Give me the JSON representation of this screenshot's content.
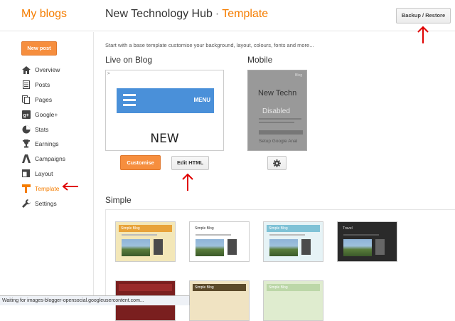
{
  "header": {
    "brand": "My blogs",
    "blog_name": "New Technology Hub",
    "separator": "·",
    "section": "Template",
    "backup_label": "Backup / Restore"
  },
  "sidebar": {
    "new_post_label": "New post",
    "items": [
      {
        "label": "Overview",
        "icon": "home-icon"
      },
      {
        "label": "Posts",
        "icon": "posts-icon"
      },
      {
        "label": "Pages",
        "icon": "pages-icon"
      },
      {
        "label": "Google+",
        "icon": "google-plus-icon"
      },
      {
        "label": "Stats",
        "icon": "stats-icon"
      },
      {
        "label": "Earnings",
        "icon": "trophy-icon"
      },
      {
        "label": "Campaigns",
        "icon": "campaigns-icon"
      },
      {
        "label": "Layout",
        "icon": "layout-icon"
      },
      {
        "label": "Template",
        "icon": "template-icon",
        "active": true
      },
      {
        "label": "Settings",
        "icon": "wrench-icon"
      }
    ]
  },
  "main": {
    "intro": "Start with a base template customise your background, layout, colours, fonts and more...",
    "live_heading": "Live on Blog",
    "mobile_heading": "Mobile",
    "live_preview": {
      "menu_label": "MENU",
      "big_text": "NEW"
    },
    "mobile_preview": {
      "blog_tag": "Blog",
      "title": "New Techn",
      "status": "Disabled",
      "setup_text": "Setup Google Anal"
    },
    "customise_label": "Customise",
    "edit_html_label": "Edit HTML",
    "simple_heading": "Simple",
    "templates": [
      {
        "title": "Simple Blog"
      },
      {
        "title": "Simple Blog"
      },
      {
        "title": "Simple Blog"
      },
      {
        "title": "Travel"
      },
      {
        "title": ""
      },
      {
        "title": "Simple Blog"
      },
      {
        "title": "Simple Blog"
      }
    ]
  },
  "status_bar": {
    "text": "Waiting for images-blogger-opensocial.googleusercontent.com..."
  },
  "colors": {
    "accent": "#f57d00",
    "button_orange": "#f68e3e",
    "annotation_red": "#e00000"
  }
}
